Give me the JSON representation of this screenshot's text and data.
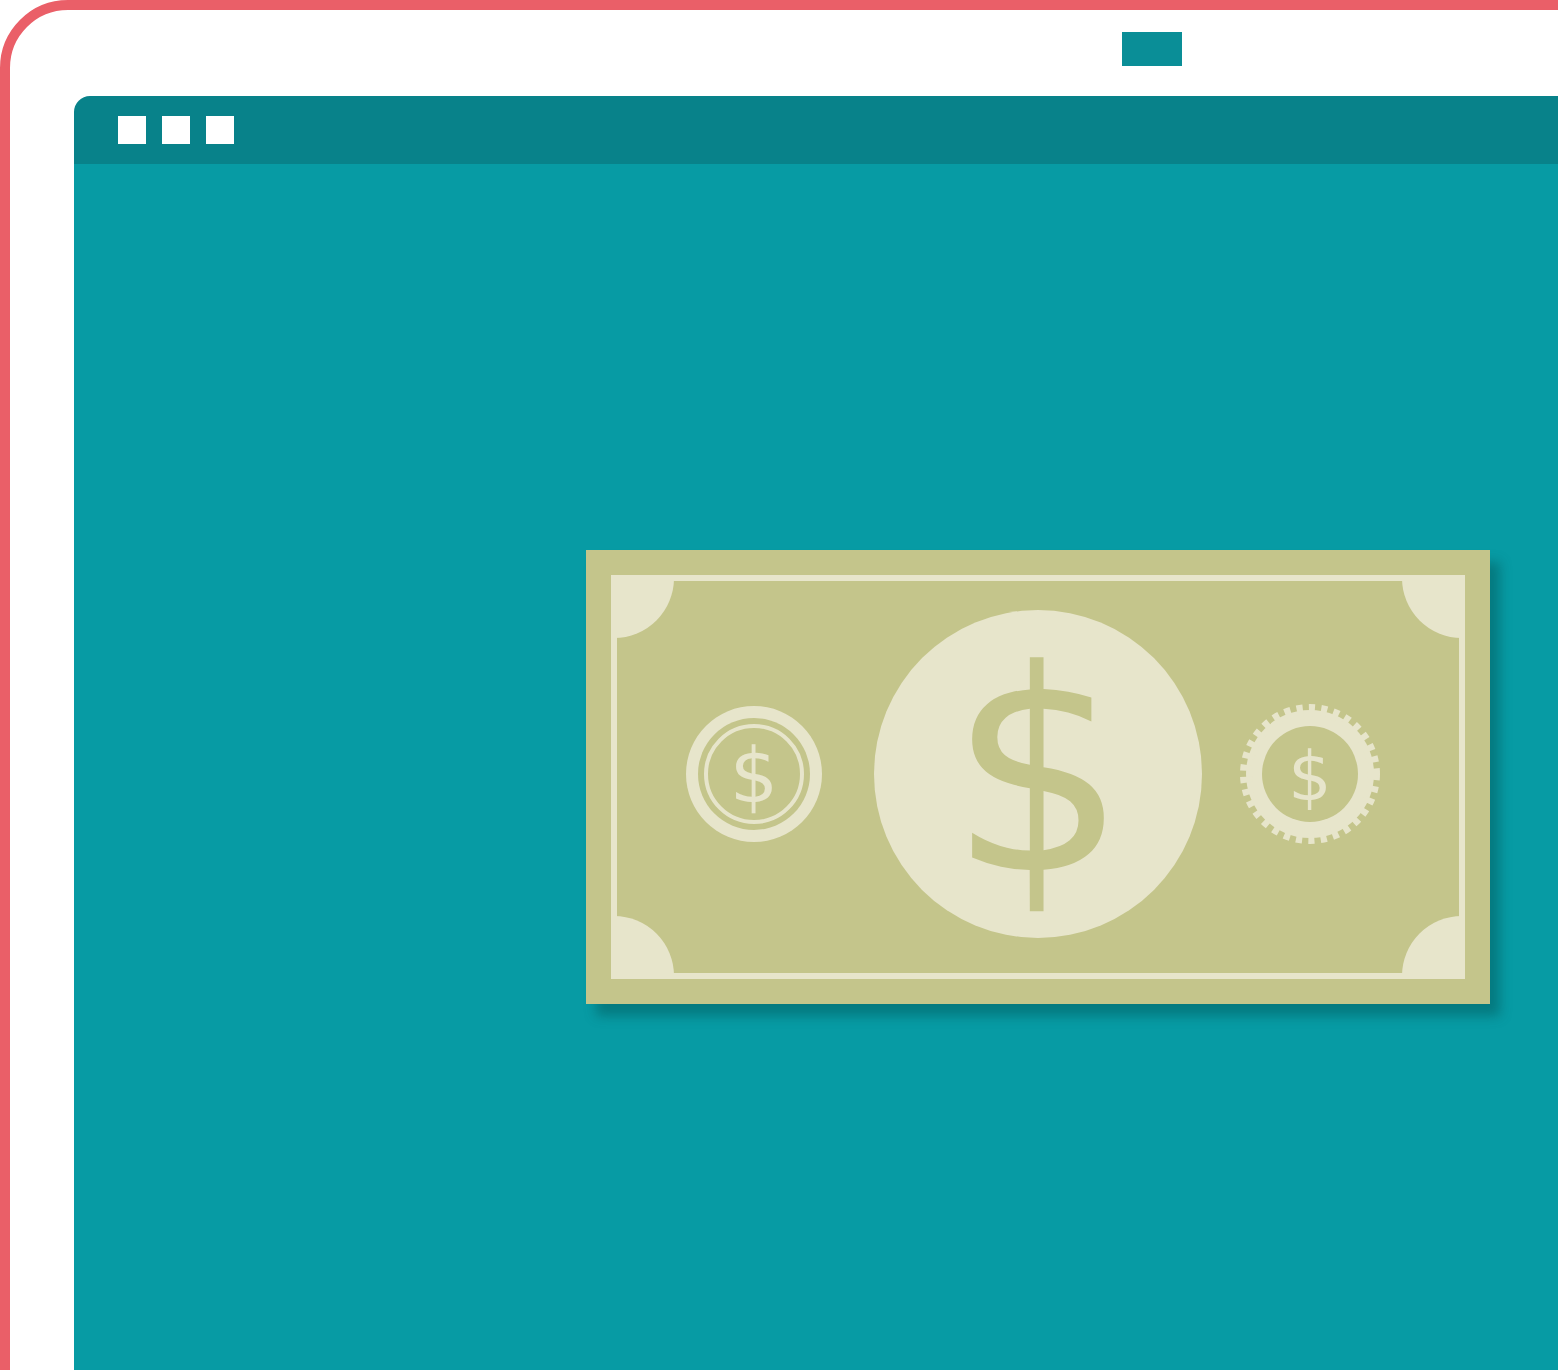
{
  "banknote": {
    "center_symbol": "$",
    "left_symbol": "$",
    "right_symbol": "$"
  }
}
